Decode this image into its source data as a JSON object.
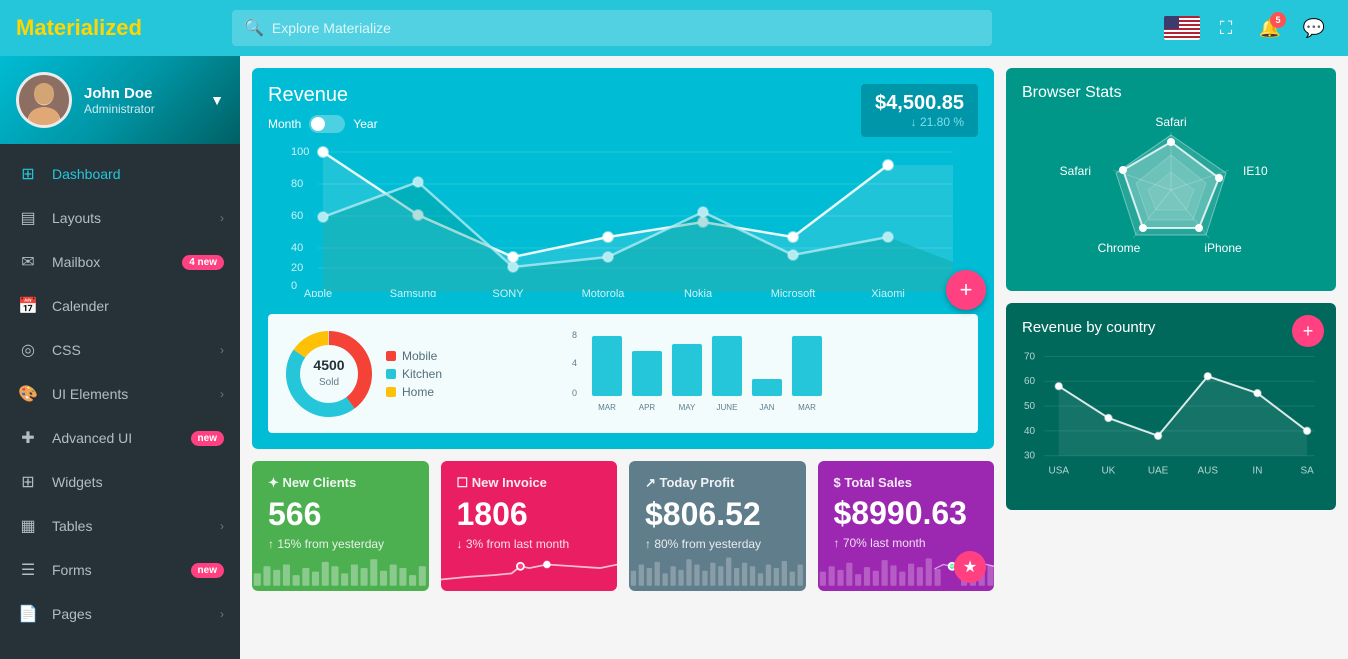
{
  "app": {
    "logo_m": "M",
    "logo_rest": "aterialized"
  },
  "topnav": {
    "search_placeholder": "Explore Materialize",
    "notification_count": "5"
  },
  "user": {
    "name": "John Doe",
    "role": "Administrator"
  },
  "sidebar": {
    "items": [
      {
        "id": "dashboard",
        "label": "Dashboard",
        "icon": "⊞",
        "active": true
      },
      {
        "id": "layouts",
        "label": "Layouts",
        "icon": "▤",
        "has_arrow": true
      },
      {
        "id": "mailbox",
        "label": "Mailbox",
        "icon": "✉",
        "badge": "4 new"
      },
      {
        "id": "calender",
        "label": "Calender",
        "icon": "📅"
      },
      {
        "id": "css",
        "label": "CSS",
        "icon": "◎",
        "has_arrow": true
      },
      {
        "id": "ui-elements",
        "label": "UI Elements",
        "icon": "🎨",
        "has_arrow": true
      },
      {
        "id": "advanced-ui",
        "label": "Advanced UI",
        "icon": "✚",
        "badge": "new"
      },
      {
        "id": "widgets",
        "label": "Widgets",
        "icon": "⊞"
      },
      {
        "id": "tables",
        "label": "Tables",
        "icon": "▦",
        "has_arrow": true
      },
      {
        "id": "forms",
        "label": "Forms",
        "icon": "☰",
        "badge": "new"
      },
      {
        "id": "pages",
        "label": "Pages",
        "icon": "📄",
        "has_arrow": true
      }
    ]
  },
  "revenue": {
    "title": "Revenue",
    "amount": "$4,500.85",
    "change": "↓ 21.80 %",
    "toggle_month": "Month",
    "toggle_year": "Year",
    "x_labels": [
      "Apple",
      "Samsung",
      "SONY",
      "Motorola",
      "Nokia",
      "Microsoft",
      "Xiaomi"
    ],
    "y_labels": [
      "0",
      "20",
      "40",
      "60",
      "80",
      "100"
    ]
  },
  "donut": {
    "value": "4500",
    "label": "Sold",
    "legend": [
      {
        "label": "Mobile",
        "color": "#F44336"
      },
      {
        "label": "Kitchen",
        "color": "#26C6DA"
      },
      {
        "label": "Home",
        "color": "#FFC107"
      }
    ]
  },
  "bar_chart": {
    "labels": [
      "MAR",
      "APR",
      "MAY",
      "JUNE",
      "JAN",
      "MAR"
    ],
    "values": [
      7,
      5,
      6,
      7,
      2,
      7
    ]
  },
  "browser_stats": {
    "title": "Browser Stats",
    "labels": [
      "Safari",
      "IE10",
      "iPhone",
      "Chrome",
      "Safari"
    ]
  },
  "country_revenue": {
    "title": "Revenue by country",
    "x_labels": [
      "USA",
      "UK",
      "UAE",
      "AUS",
      "IN",
      "SA"
    ],
    "y_labels": [
      "30",
      "40",
      "50",
      "60",
      "70"
    ],
    "values": [
      58,
      45,
      38,
      62,
      55,
      40
    ]
  },
  "stat_cards": [
    {
      "id": "new-clients",
      "title": "✦ New Clients",
      "value": "566",
      "change": "↑ 15% from yesterday",
      "color": "card-green"
    },
    {
      "id": "new-invoice",
      "title": "☐ New Invoice",
      "value": "1806",
      "change": "↓ 3% from last month",
      "color": "card-pink"
    },
    {
      "id": "today-profit",
      "title": "↗ Today Profit",
      "value": "$806.52",
      "change": "↑ 80% from yesterday",
      "color": "card-gray"
    },
    {
      "id": "total-sales",
      "title": "$ Total Sales",
      "value": "$8990.63",
      "change": "↑ 70% last month",
      "color": "card-purple"
    }
  ]
}
